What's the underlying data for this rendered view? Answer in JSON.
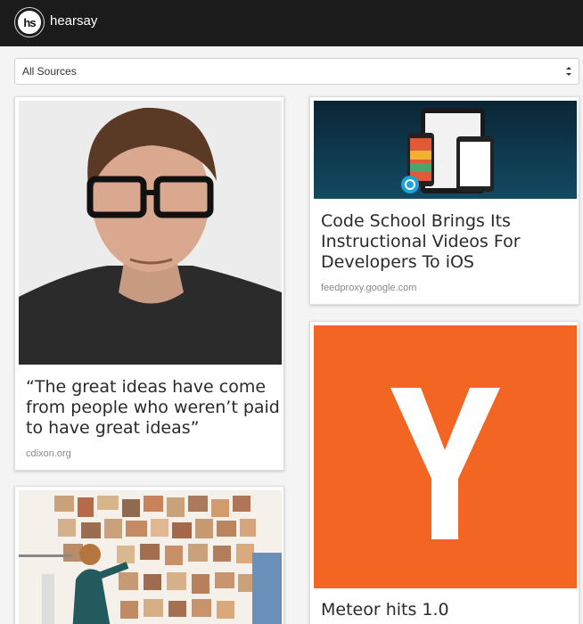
{
  "app": {
    "name": "hearsay",
    "logo_text": "hs"
  },
  "filter": {
    "selected": "All Sources"
  },
  "cards": [
    {
      "title": "“The great ideas have come from people who weren’t paid to have great ideas”",
      "source": "cdixon.org",
      "image": "portrait-photo"
    },
    {
      "title": "Code School Brings Its Instructional Videos For Developers To iOS",
      "source": "feedproxy.google.com",
      "image": "app-screens-photo"
    },
    {
      "title": "",
      "source": "",
      "image": "collage-wall-photo"
    },
    {
      "title": "Meteor hits 1.0",
      "source": "",
      "image": "y-combinator-logo"
    }
  ],
  "colors": {
    "topbar": "#1b1b1b",
    "yc_orange": "#f26522",
    "card_bg": "#ffffff",
    "page_bg": "#f4f4f4"
  }
}
